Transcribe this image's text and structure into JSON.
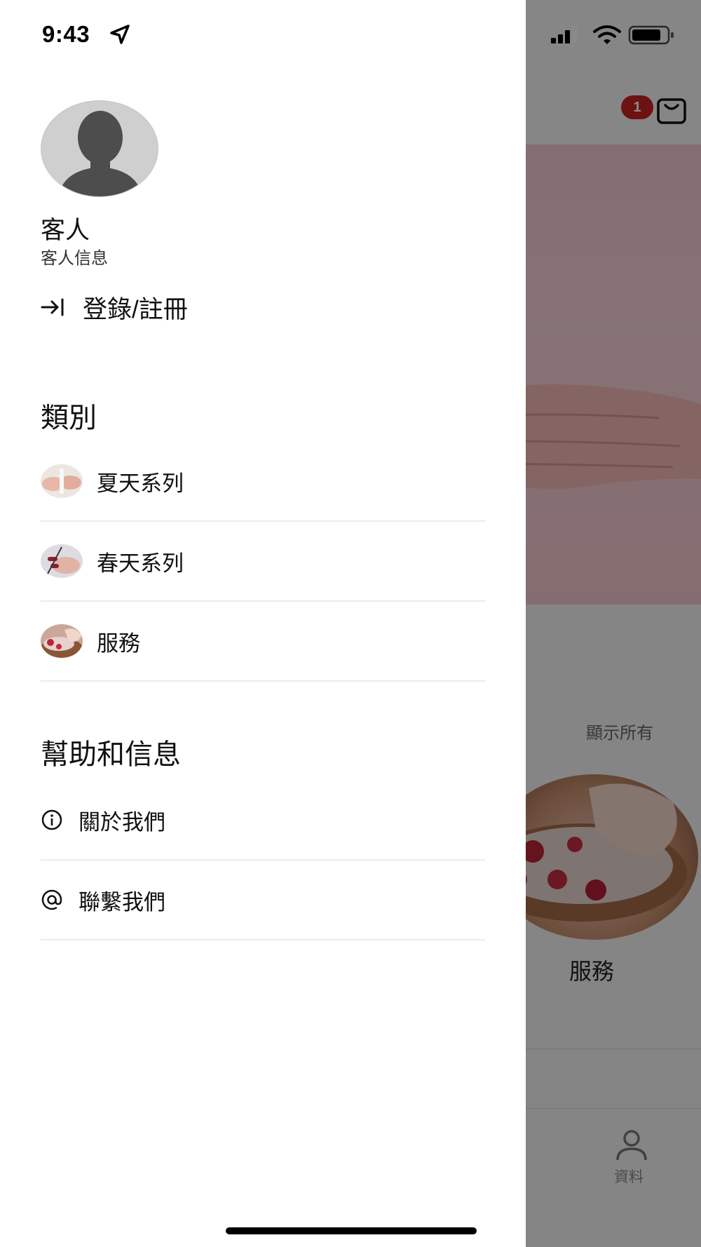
{
  "status_bar": {
    "time": "9:43"
  },
  "background_app": {
    "cart_badge_count": "1",
    "show_all_label": "顯示所有",
    "featured_category_label": "服務",
    "tab_profile_label": "資料",
    "colors": {
      "badge": "#c62222",
      "overlay": "rgba(0,0,0,0.45)"
    }
  },
  "drawer": {
    "user_name": "客人",
    "user_subtitle": "客人信息",
    "login_label": "登錄/註冊",
    "categories_title": "類別",
    "categories": [
      {
        "label": "夏天系列",
        "thumb_icon": "summer-collection-thumb"
      },
      {
        "label": "春天系列",
        "thumb_icon": "spring-collection-thumb"
      },
      {
        "label": "服務",
        "thumb_icon": "service-thumb"
      }
    ],
    "help_title": "幫助和信息",
    "help_items": [
      {
        "label": "關於我們",
        "icon": "info-icon"
      },
      {
        "label": "聯繫我們",
        "icon": "at-sign-icon"
      }
    ]
  }
}
